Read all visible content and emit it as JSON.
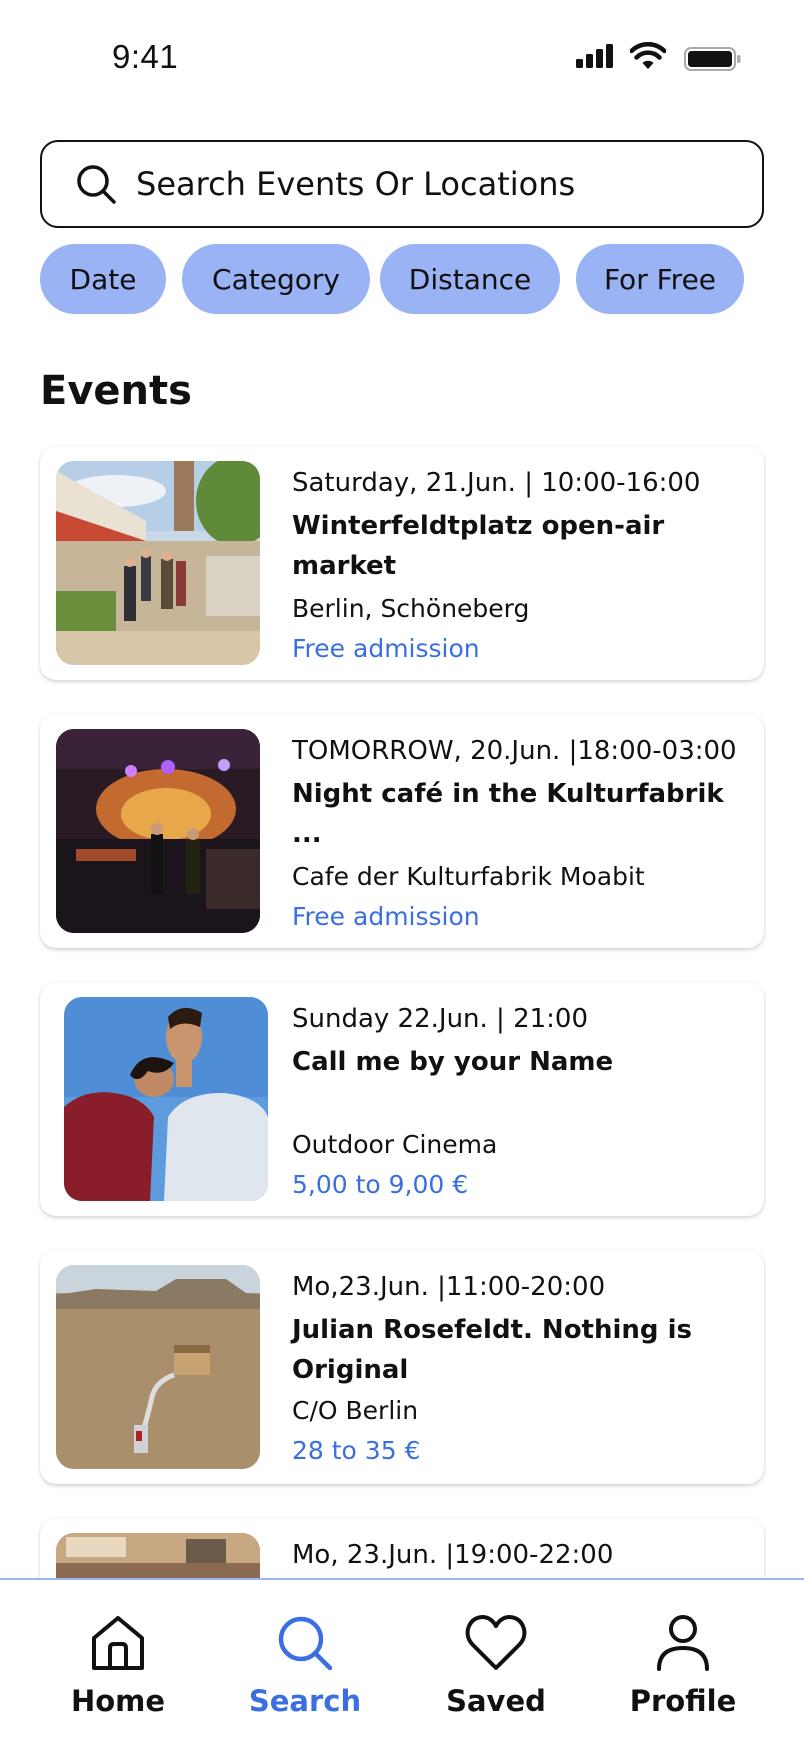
{
  "status_bar": {
    "time": "9:41"
  },
  "search": {
    "placeholder": "Search Events Or Locations"
  },
  "filters": [
    "Date",
    "Category",
    "Distance",
    "For Free"
  ],
  "section_title": "Events",
  "events": [
    {
      "date": "Saturday, 21.Jun. | 10:00-16:00",
      "title": "Winterfeldtplatz open-air market",
      "location": "Berlin, Schöneberg",
      "price": "Free admission",
      "image": "market-photo"
    },
    {
      "date": "TOMORROW, 20.Jun. |18:00-03:00",
      "title": "Night café in the Kulturfabrik ...",
      "location": "Cafe der Kulturfabrik Moabit",
      "price": "Free admission",
      "image": "night-cafe-photo"
    },
    {
      "date": "Sunday 22.Jun. | 21:00",
      "title": "Call me by your Name",
      "location": "Outdoor Cinema",
      "price": "5,00 to 9,00 €",
      "image": "movie-poster"
    },
    {
      "date": "Mo,23.Jun. |11:00-20:00",
      "title": "Julian Rosefeldt. Nothing is Original",
      "location": "C/O Berlin",
      "price": "28 to 35 €",
      "image": "desert-photo"
    },
    {
      "date": "Mo, 23.Jun. |19:00-22:00",
      "title": "",
      "location": "",
      "price": "",
      "image": "interior-photo"
    }
  ],
  "tabs": [
    {
      "label": "Home",
      "icon": "home-icon",
      "active": false
    },
    {
      "label": "Search",
      "icon": "search-icon",
      "active": true
    },
    {
      "label": "Saved",
      "icon": "heart-icon",
      "active": false
    },
    {
      "label": "Profile",
      "icon": "person-icon",
      "active": false
    }
  ],
  "colors": {
    "accent": "#3b6fe0",
    "chip": "#9ab3f5",
    "text": "#111111"
  }
}
